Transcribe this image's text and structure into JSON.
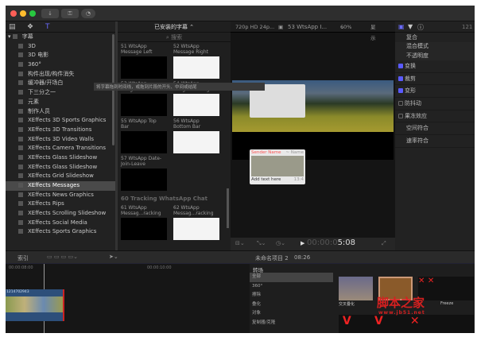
{
  "toolbar": {
    "buttons": [
      "download-icon",
      "key-icon",
      "progress-icon"
    ]
  },
  "sidebar": {
    "root": "字幕",
    "items": [
      "3D",
      "3D 电影",
      "360°",
      "构件出现/构件消失",
      "缓冲器/开场白",
      "下三分之一",
      "元素",
      "制作人员",
      "XEffects 3D Sports Graphics",
      "XEffects 3D Transitions",
      "XEffects 3D Video Walls",
      "XEffects Camera Transitions",
      "XEffects Glass Slideshow",
      "XEffects Glass Slideshow",
      "XEffects Grid Slideshow",
      "XEffects Messages",
      "XEffects News Graphics",
      "XEffects Rips",
      "XEffects Scrolling Slideshow",
      "XEffects Social Media",
      "XEffects Sports Graphics"
    ],
    "selected": "XEffects Messages"
  },
  "browser": {
    "title": "已安装的字幕 ⌃",
    "search_placeholder": "搜索",
    "tooltip": "将字幕拖到时间线，或拖到片段的开头、中间或结尾",
    "items": [
      {
        "l1": "51 WtsApp",
        "l2": "Message Left"
      },
      {
        "l1": "52 WtsApp",
        "l2": "Message Right"
      },
      {
        "l1": "53 WtsApp",
        "l2": "Image-Video Left"
      },
      {
        "l1": "54 WtsApp",
        "l2": "Image-...eo Right"
      },
      {
        "l1": "55 WtsApp Top",
        "l2": "Bar"
      },
      {
        "l1": "56 WtsApp",
        "l2": "Bottom Bar"
      },
      {
        "l1": "57 WtsApp Date-",
        "l2": "Join-Leave"
      }
    ],
    "section": "60 Tracking WhatsApp Chat",
    "items2": [
      {
        "l1": "61 WtsApp",
        "l2": "Messag...racking"
      },
      {
        "l1": "62 WtsApp",
        "l2": "Messag...racking"
      }
    ]
  },
  "viewer": {
    "format": "720p HD 24p...",
    "clip": "53 WtsApp I...",
    "zoom": "60%",
    "display": "显示",
    "sender": "Sender Name",
    "name_right": "~ Name",
    "text": "Add text here",
    "time_small": "13:4",
    "timecode_dim": "00:00:0",
    "timecode": "5:08"
  },
  "inspector": {
    "header_num": "121",
    "composite": "复合",
    "blend": "混合模式",
    "opacity": "不透明度",
    "rows": [
      {
        "label": "变换",
        "checked": true
      },
      {
        "label": "裁剪",
        "checked": true
      },
      {
        "label": "变形",
        "checked": true
      },
      {
        "label": "防抖动",
        "checked": false
      },
      {
        "label": "果冻效应",
        "checked": false
      }
    ],
    "spatial": "空间符合",
    "rate": "速率符合"
  },
  "timeline": {
    "index": "索引",
    "project": "未命名项目 2",
    "duration": "08:26",
    "t1": "00:00:08:00",
    "t2": "00:00:10:00",
    "clip": "1214702943"
  },
  "transitions": {
    "title": "转场",
    "categories": [
      "全部",
      "360°",
      "擦除",
      "叠化",
      "对象",
      "复制器/克隆"
    ],
    "selected": "全部",
    "thumb1": "交叉叠化",
    "thumb3": "Freeze"
  },
  "watermark": {
    "line1": "脚本之家",
    "line2": "www.jb51.net"
  }
}
